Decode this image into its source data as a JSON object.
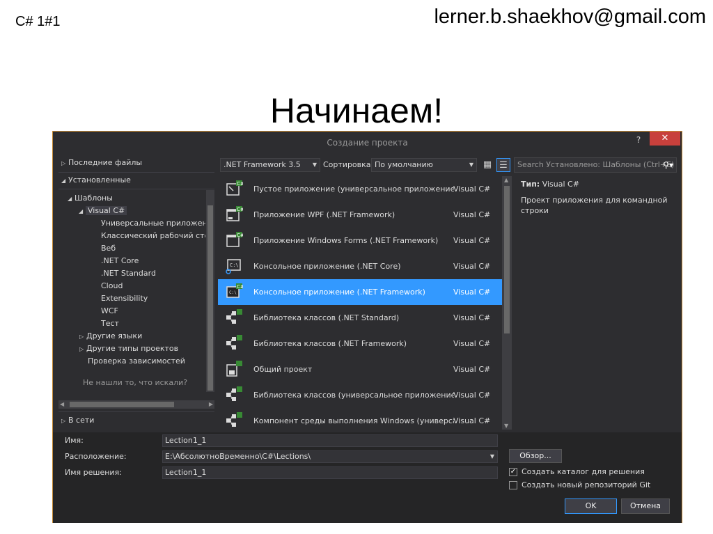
{
  "slide": {
    "tag": "C# 1#1",
    "email": "lerner.b.shaekhov@gmail.com",
    "title": "Начинаем!"
  },
  "dialog": {
    "title": "Создание проекта",
    "help": "?",
    "close": "✕",
    "left_panel": {
      "recent": "Последние файлы",
      "installed": "Установленные",
      "templates": "Шаблоны",
      "visual_csharp": "Visual C#",
      "children": [
        "Универсальные приложения Windows",
        "Классический рабочий стол Windows",
        "Веб",
        ".NET Core",
        ".NET Standard",
        "Cloud",
        "Extensibility",
        "WCF",
        "Тест"
      ],
      "other_languages": "Другие языки",
      "other_project_types": "Другие типы проектов",
      "dependency_check": "Проверка зависимостей",
      "not_found_link": "Не нашли то, что искали?",
      "online": "В сети"
    },
    "toolbar": {
      "framework": ".NET Framework 3.5",
      "sort_label": "Сортировка:",
      "sort_value": "По умолчанию",
      "search_placeholder": "Search Установлено: Шаблоны (Ctrl+E)"
    },
    "templates": [
      {
        "name": "Пустое приложение (универсальное приложение Windows)",
        "lang": "Visual C#",
        "icon": "uwp-app-icon"
      },
      {
        "name": "Приложение WPF (.NET Framework)",
        "lang": "Visual C#",
        "icon": "wpf-app-icon"
      },
      {
        "name": "Приложение Windows Forms (.NET Framework)",
        "lang": "Visual C#",
        "icon": "winforms-app-icon"
      },
      {
        "name": "Консольное приложение (.NET Core)",
        "lang": "Visual C#",
        "icon": "console-core-icon"
      },
      {
        "name": "Консольное приложение (.NET Framework)",
        "lang": "Visual C#",
        "icon": "console-app-icon"
      },
      {
        "name": "Библиотека классов (.NET Standard)",
        "lang": "Visual C#",
        "icon": "class-library-icon"
      },
      {
        "name": "Библиотека классов (.NET Framework)",
        "lang": "Visual C#",
        "icon": "class-library-icon"
      },
      {
        "name": "Общий проект",
        "lang": "Visual C#",
        "icon": "shared-project-icon"
      },
      {
        "name": "Библиотека классов (универсальное приложение Windows)",
        "lang": "Visual C#",
        "icon": "class-library-icon"
      },
      {
        "name": "Компонент среды выполнения Windows (универсальное приложение Windows)",
        "lang": "Visual C#",
        "icon": "runtime-component-icon"
      }
    ],
    "selected_template": "Консольное приложение (.NET Framework)",
    "info": {
      "type_label": "Тип:",
      "type_value": "Visual C#",
      "description": "Проект приложения для командной строки"
    },
    "form": {
      "name_label": "Имя:",
      "name_value": "Lection1_1",
      "location_label": "Расположение:",
      "location_value": "E:\\АбсолютноВременно\\C#\\Lections\\",
      "solution_label": "Имя решения:",
      "solution_value": "Lection1_1",
      "browse": "Обзор...",
      "create_dir_label": "Создать каталог для решения",
      "create_dir_checked": true,
      "create_git_label": "Создать новый репозиторий Git",
      "create_git_checked": false,
      "ok": "OK",
      "cancel": "Отмена"
    }
  }
}
